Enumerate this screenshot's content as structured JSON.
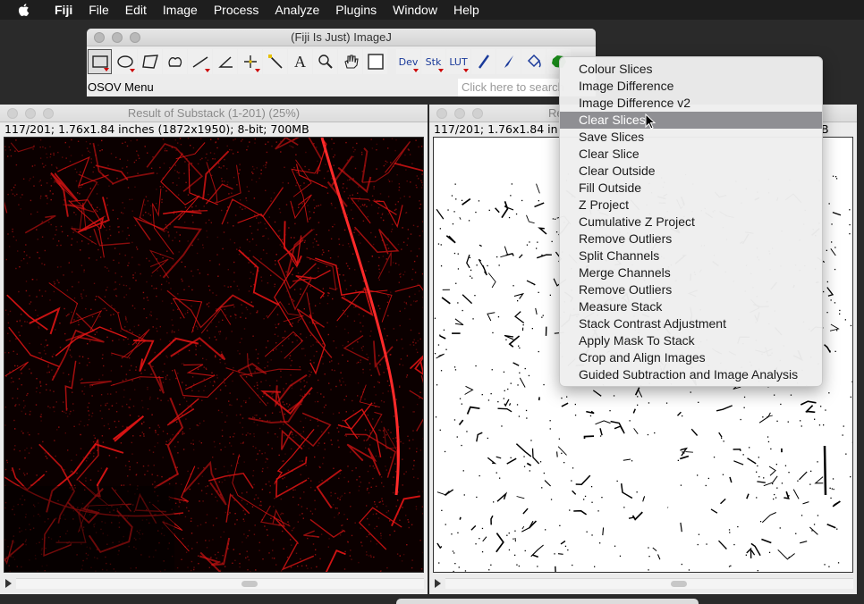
{
  "menubar": {
    "app": "Fiji",
    "items": [
      "File",
      "Edit",
      "Image",
      "Process",
      "Analyze",
      "Plugins",
      "Window",
      "Help"
    ]
  },
  "imagej": {
    "title": "(Fiji Is Just) ImageJ",
    "tools": [
      {
        "name": "rectangle-tool-icon",
        "selected": true
      },
      {
        "name": "oval-tool-icon"
      },
      {
        "name": "polygon-tool-icon"
      },
      {
        "name": "freehand-tool-icon"
      },
      {
        "name": "line-tool-icon"
      },
      {
        "name": "angle-tool-icon"
      },
      {
        "name": "point-tool-icon"
      },
      {
        "name": "wand-tool-icon"
      },
      {
        "name": "text-tool-icon",
        "label": "A"
      },
      {
        "name": "magnifier-tool-icon"
      },
      {
        "name": "hand-tool-icon"
      },
      {
        "name": "color-picker-tool-icon"
      },
      {
        "name": "dev-menu-button",
        "label": "Dev"
      },
      {
        "name": "stk-menu-button",
        "label": "Stk"
      },
      {
        "name": "lut-menu-button",
        "label": "LUT"
      },
      {
        "name": "pencil-tool-icon"
      },
      {
        "name": "brush-tool-icon"
      },
      {
        "name": "flood-fill-tool-icon"
      },
      {
        "name": "osov-tool-icon"
      }
    ],
    "menu_label": "OSOV Menu",
    "search_placeholder": "Click here to search"
  },
  "left_window": {
    "title": "Result of Substack (1-201) (25%)",
    "info": "117/201; 1.76x1.84 inches (1872x1950); 8-bit; 700MB"
  },
  "right_window": {
    "title": "Re",
    "info": "117/201; 1.76x1.84 in",
    "info_tail": "B"
  },
  "dropdown": {
    "items": [
      "Colour Slices",
      "Image Difference",
      "Image Difference v2",
      "Clear Slices",
      "Save Slices",
      "Clear Slice",
      "Clear Outside",
      "Fill Outside",
      "Z Project",
      "Cumulative Z Project",
      "Remove Outliers",
      "Split Channels",
      "Merge Channels",
      "Remove Outliers",
      "Measure Stack",
      "Stack Contrast Adjustment",
      "Apply Mask To Stack",
      "Crop and Align Images",
      "Guided Subtraction and Image Analysis"
    ],
    "highlighted_index": 3
  },
  "colors": {
    "menubar": "#1e1e1e",
    "highlight": "#8f8f93",
    "vessel_red": "#e01010"
  }
}
